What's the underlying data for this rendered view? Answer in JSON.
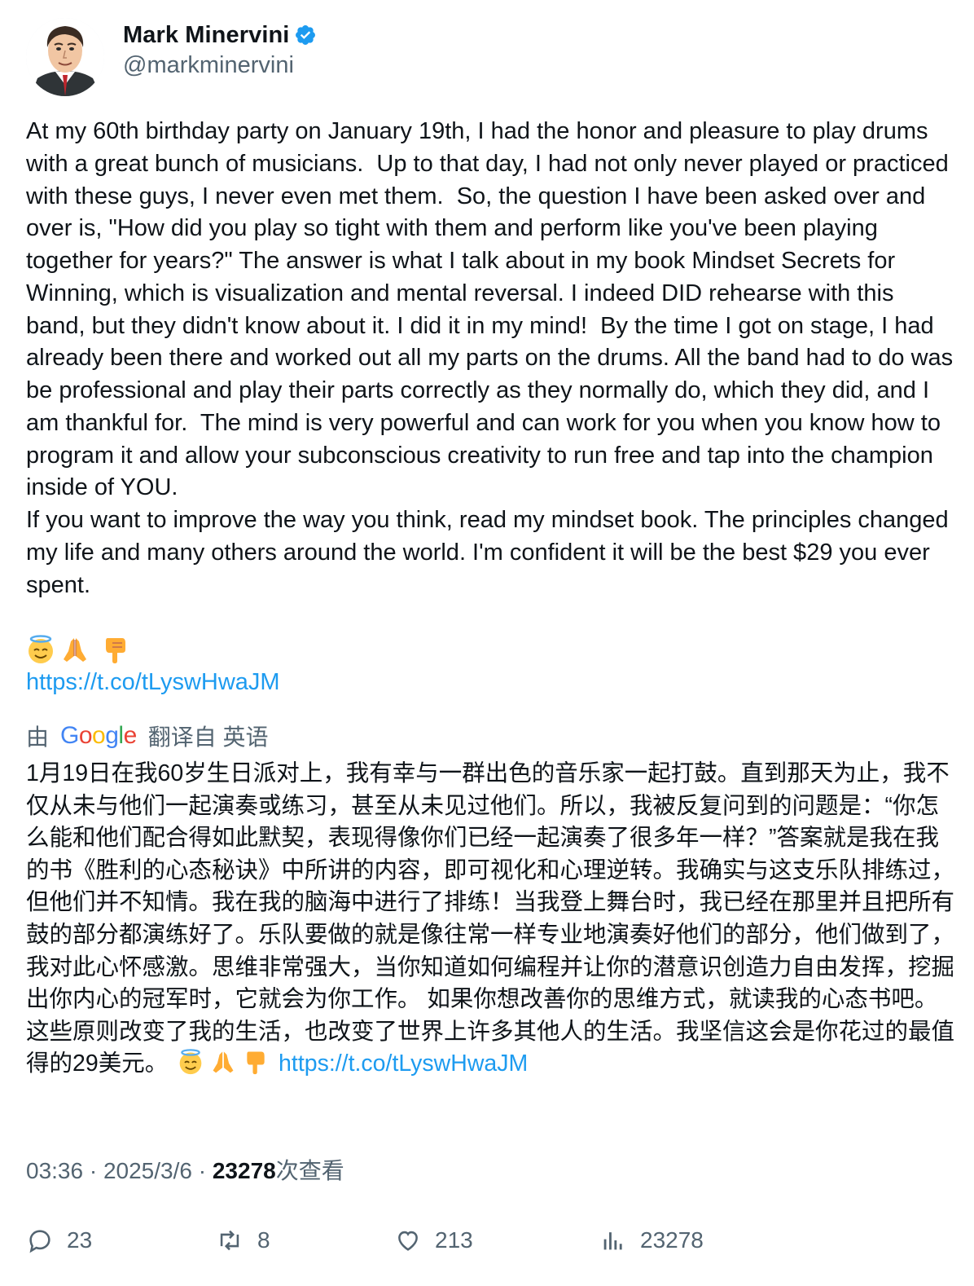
{
  "author": {
    "name": "Mark Minervini",
    "handle": "@markminervini",
    "verified": true,
    "avatar_icon": "avatar-caricature-icon"
  },
  "tweet": {
    "body": "At my 60th birthday party on January 19th, I had the honor and pleasure to play drums with a great bunch of musicians.  Up to that day, I had not only never played or practiced with these guys, I never even met them.  So, the question I have been asked over and over is, \"How did you play so tight with them and perform like you've been playing together for years?\" The answer is what I talk about in my book Mindset Secrets for Winning, which is visualization and mental reversal. I indeed DID rehearse with this band, but they didn't know about it. I did it in my mind!  By the time I got on stage, I had already been there and worked out all my parts on the drums. All the band had to do was be professional and play their parts correctly as they normally do, which they did, and I am thankful for.  The mind is very powerful and can work for you when you know how to program it and allow your subconscious creativity to run free and tap into the champion inside of YOU.\nIf you want to improve the way you think, read my mindset book. The principles changed my life and many others around the world. I'm confident it will be the best $29 you ever spent.",
    "emojis": [
      "halo-face-icon",
      "praying-hands-icon",
      "pointing-down-icon"
    ],
    "link": "https://t.co/tLyswHwaJM"
  },
  "translation": {
    "prefix": "由",
    "provider": "Google",
    "suffix": "翻译自 英语",
    "text": "1月19日在我60岁生日派对上，我有幸与一群出色的音乐家一起打鼓。直到那天为止，我不仅从未与他们一起演奏或练习，甚至从未见过他们。所以，我被反复问到的问题是：“你怎么能和他们配合得如此默契，表现得像你们已经一起演奏了很多年一样？”答案就是我在我的书《胜利的心态秘诀》中所讲的内容，即可视化和心理逆转。我确实与这支乐队排练过，但他们并不知情。我在我的脑海中进行了排练！当我登上舞台时，我已经在那里并且把所有鼓的部分都演练好了。乐队要做的就是像往常一样专业地演奏好他们的部分，他们做到了，我对此心怀感激。思维非常强大，当你知道如何编程并让你的潜意识创造力自由发挥，挖掘出你内心的冠军时，它就会为你工作。 如果你想改善你的思维方式，就读我的心态书吧。这些原则改变了我的生活，也改变了世界上许多其他人的生活。我坚信这会是你花过的最值得的29美元。",
    "link": "https://t.co/tLyswHwaJM"
  },
  "meta": {
    "time": "03:36",
    "sep": " · ",
    "date": "2025/3/6",
    "views_count": "23278",
    "views_label": "次查看"
  },
  "actions": {
    "replies": "23",
    "reposts": "8",
    "likes": "213",
    "views": "23278"
  },
  "colors": {
    "link": "#1d9bf0",
    "verified": "#1d9bf0",
    "secondary_text": "#536471",
    "primary_text": "#0f1419"
  }
}
